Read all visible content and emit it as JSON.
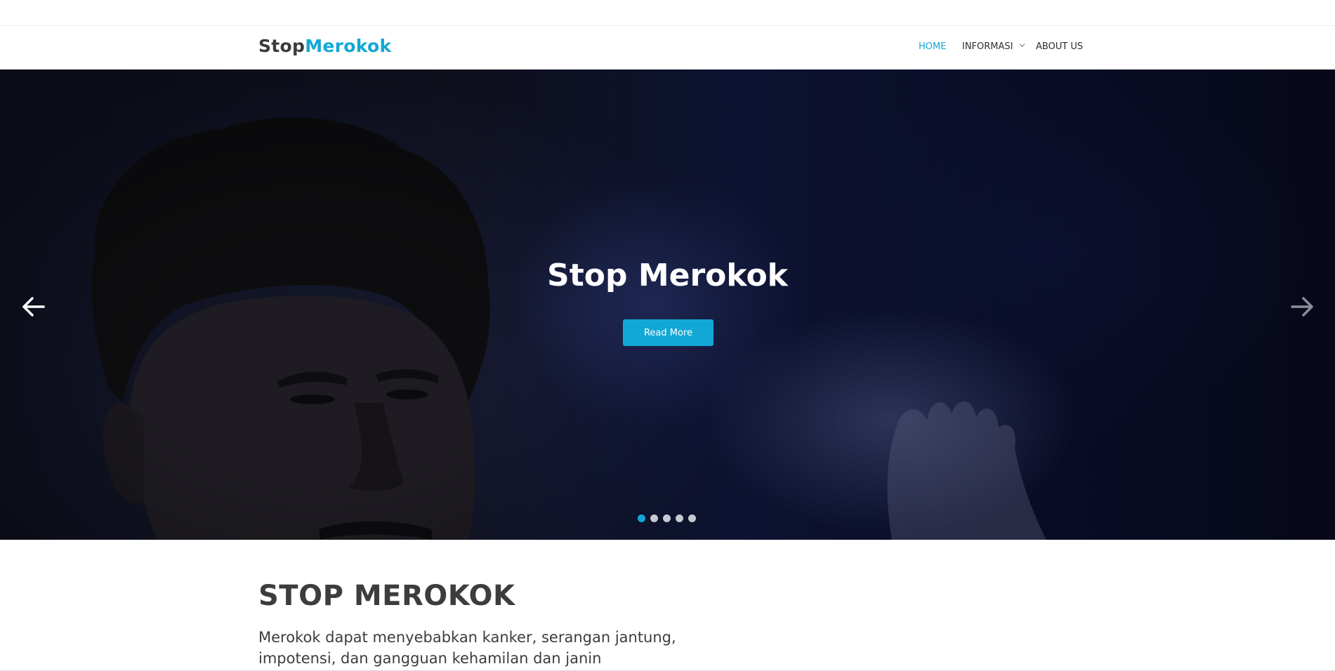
{
  "header": {
    "brand": {
      "part1": "Stop",
      "part2": "Merokok"
    },
    "nav": [
      {
        "label": "HOME",
        "active": true
      },
      {
        "label": "INFORMASI",
        "has_dropdown": true
      },
      {
        "label": "ABOUT US"
      }
    ]
  },
  "hero": {
    "title": "Stop Merokok",
    "button_label": "Read More",
    "slides_count": 5,
    "active_slide": 1,
    "prev_icon": "arrow-left-icon",
    "next_icon": "arrow-right-icon"
  },
  "intro": {
    "title": "STOP MEROKOK",
    "text": "Merokok dapat menyebabkan kanker, serangan jantung, impotensi, dan gangguan kehamilan dan janin"
  },
  "colors": {
    "accent": "#12a8d6",
    "text": "#3d3d3d",
    "hero_bg": "#141c4a"
  }
}
